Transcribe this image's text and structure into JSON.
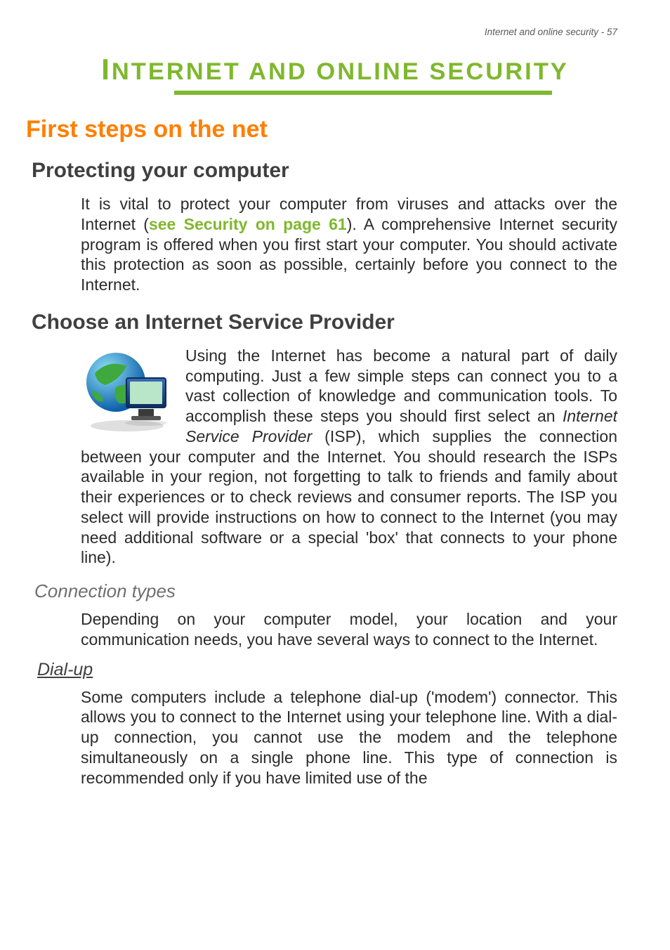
{
  "running_header": "Internet and online security - 57",
  "chapter_title_1": "I",
  "chapter_title_rest": "NTERNET AND ONLINE SECURITY",
  "h1_first_steps": "First steps on the net",
  "h2_protecting": "Protecting your computer",
  "para_protect_a": "It is vital to protect your computer from viruses and attacks over the Internet (",
  "link_security": "see Security on page 61",
  "para_protect_b": "). A comprehensive Internet security program is offered when you first start your computer. You should activate this protection as soon as possible, certainly before you connect to the Internet.",
  "h2_choose_isp": "Choose an Internet Service Provider",
  "para_isp_a": "Using the Internet has become a natural part of daily computing. Just a few simple steps can connect you to a vast collection of knowledge and communication tools. To accomplish these steps you should first select an ",
  "isp_term": "Internet Service Provider",
  "para_isp_b": " (ISP), which supplies the connection between your computer and the Internet. You should research the ISPs available in your region, not forgetting to talk to friends and family about their experiences or to check reviews and consumer reports. The ISP you select will provide instructions on how to connect to the Internet (you may need additional software or a special 'box' that connects to your phone line).",
  "h3_conn_types": "Connection types",
  "para_conn": "Depending on your computer model, your location and your communication needs, you have several ways to connect to the Internet.",
  "h4_dialup": "Dial-up",
  "para_dialup": "Some computers include a telephone dial-up ('modem') connector. This allows you to connect to the Internet using your telephone line. With a dial-up connection, you cannot use the modem and the telephone simultaneously on a single phone line. This type of connection is recommended only if you have limited use of the",
  "illustration_alt": "globe-with-monitor-icon"
}
